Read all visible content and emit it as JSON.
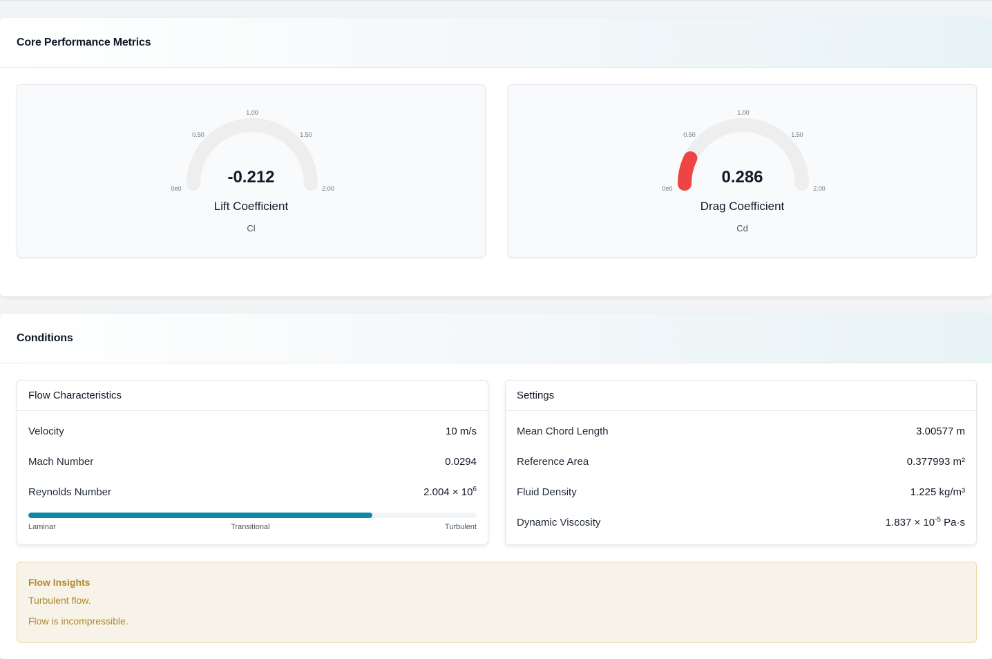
{
  "metrics": {
    "title": "Core Performance Metrics",
    "gauges": [
      {
        "name": "Lift Coefficient",
        "symbol": "Cl",
        "value_text": "-0.212",
        "value": -0.212,
        "min": 0,
        "max": 2,
        "ticks": [
          "0e0",
          "0.50",
          "1.00",
          "1.50",
          "2.00"
        ],
        "fill_color": "#ef4444"
      },
      {
        "name": "Drag Coefficient",
        "symbol": "Cd",
        "value_text": "0.286",
        "value": 0.286,
        "min": 0,
        "max": 2,
        "ticks": [
          "0e0",
          "0.50",
          "1.00",
          "1.50",
          "2.00"
        ],
        "fill_color": "#ef4444"
      }
    ]
  },
  "conditions": {
    "title": "Conditions",
    "flow": {
      "title": "Flow Characteristics",
      "rows": [
        {
          "label": "Velocity",
          "value": "10 m/s"
        },
        {
          "label": "Mach Number",
          "value": "0.0294"
        },
        {
          "label": "Reynolds Number",
          "value": "2.004 × 10",
          "exp": "6"
        }
      ],
      "regime": {
        "fraction": 0.767,
        "labels": [
          "Laminar",
          "Transitional",
          "Turbulent"
        ],
        "color": "#0e8aa8"
      }
    },
    "settings": {
      "title": "Settings",
      "rows": [
        {
          "label": "Mean Chord Length",
          "value": "3.00577 m"
        },
        {
          "label": "Reference Area",
          "value": "0.377993 m²"
        },
        {
          "label": "Fluid Density",
          "value": "1.225 kg/m³"
        },
        {
          "label": "Dynamic Viscosity",
          "value": "1.837 × 10",
          "exp": "-5",
          "unit": " Pa·s"
        }
      ]
    },
    "insights": {
      "title": "Flow Insights",
      "lines": [
        "Turbulent flow.",
        "Flow is incompressible."
      ]
    }
  }
}
